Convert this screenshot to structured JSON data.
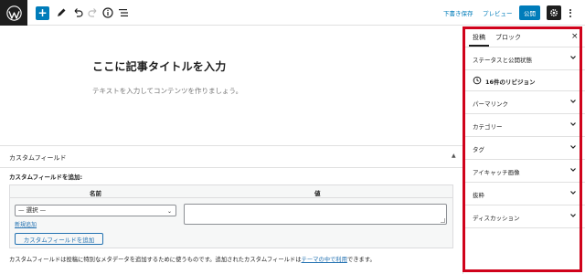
{
  "toolbar": {
    "logo_icon": "wordpress-icon",
    "add_label": "+",
    "save_draft": "下書き保存",
    "preview": "プレビュー",
    "publish": "公開",
    "accent": "#007cba"
  },
  "editor": {
    "title": "ここに記事タイトルを入力",
    "body_placeholder": "テキストを入力してコンテンツを作りましょう。"
  },
  "custom_fields": {
    "header": "カスタムフィールド",
    "add_label": "カスタムフィールドを追加:",
    "col_name": "名前",
    "col_value": "値",
    "select_value": "— 選択 —",
    "new_link": "新規追加",
    "add_button": "カスタムフィールドを追加",
    "note_before": "カスタムフィールドは投稿に特別なメタデータを追加するために使うものです。追加されたカスタムフィールドは",
    "note_link": "テーマの中で利用",
    "note_after": "できます。"
  },
  "sidebar": {
    "tab_post": "投稿",
    "tab_block": "ブロック",
    "close": "×",
    "status_panel": "ステータスと公開状態",
    "revisions": "16件のリビジョン",
    "panels": [
      "パーマリンク",
      "カテゴリー",
      "タグ",
      "アイキャッチ画像",
      "抜粋",
      "ディスカッション"
    ],
    "highlight_color": "#d0021b"
  }
}
